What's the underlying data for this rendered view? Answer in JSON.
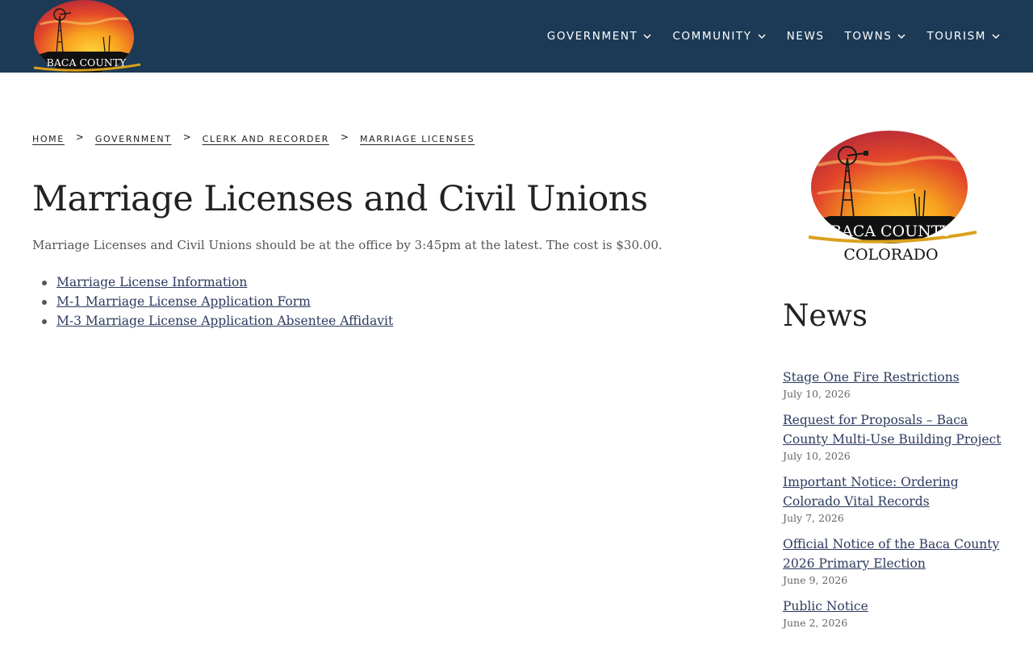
{
  "header": {
    "logo_text": "BACA COUNTY",
    "nav": [
      {
        "label": "GOVERNMENT",
        "has_dropdown": true
      },
      {
        "label": "COMMUNITY",
        "has_dropdown": true
      },
      {
        "label": "NEWS",
        "has_dropdown": false
      },
      {
        "label": "TOWNS",
        "has_dropdown": true
      },
      {
        "label": "TOURISM",
        "has_dropdown": true
      }
    ],
    "bg_color": "#1c3a56"
  },
  "breadcrumb": [
    "HOME",
    "GOVERNMENT",
    "CLERK AND RECORDER",
    "MARRIAGE LICENSES"
  ],
  "breadcrumb_separator": ">",
  "main": {
    "title": "Marriage Licenses and Civil Unions",
    "intro": "Marriage Licenses and Civil Unions should be at the office by 3:45pm at the latest. The cost is $30.00.",
    "links": [
      "Marriage License Information",
      "M-1 Marriage License Application Form",
      "M-3 Marriage License Application Absentee Affidavit"
    ]
  },
  "sidebar": {
    "logo_line1": "BACA COUNTY",
    "logo_line2": "COLORADO",
    "news_heading": "News",
    "news": [
      {
        "title": "Stage One Fire Restrictions",
        "date": "July 10, 2026"
      },
      {
        "title": "Request for Proposals – Baca County Multi-Use Building Project",
        "date": "July 10, 2026"
      },
      {
        "title": "Important Notice: Ordering Colorado Vital Records",
        "date": "July 7, 2026"
      },
      {
        "title": "Official Notice of the Baca County 2026 Primary Election",
        "date": "June 9, 2026"
      },
      {
        "title": "Public Notice",
        "date": "June 2, 2026"
      }
    ]
  }
}
